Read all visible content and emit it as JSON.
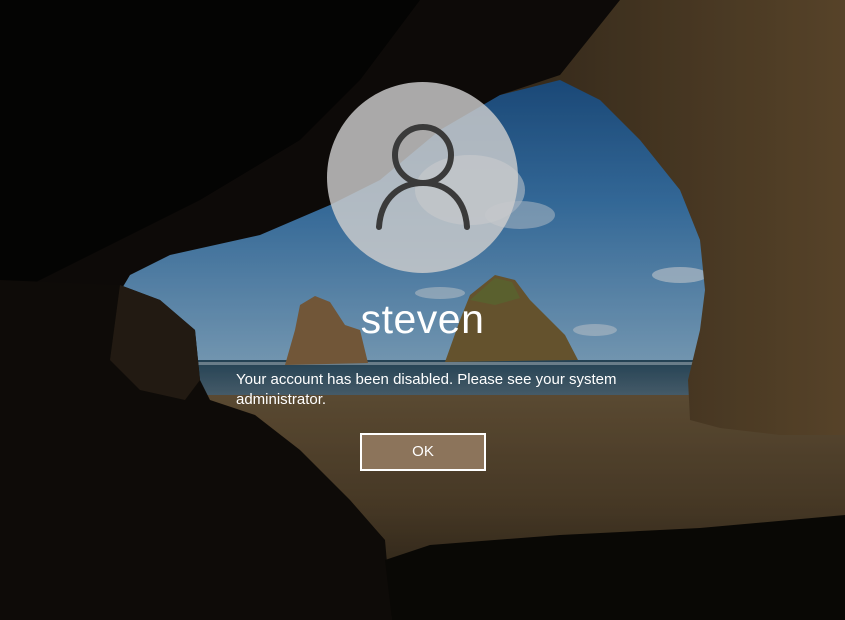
{
  "user": {
    "avatar_icon": "user-silhouette-icon",
    "name": "steven"
  },
  "message": {
    "text": "Your account has been disabled.  Please see your system administrator."
  },
  "actions": {
    "ok_label": "OK"
  },
  "colors": {
    "avatar_bg": "#cdcdcd",
    "button_bg": "#917860",
    "text": "#ffffff"
  }
}
